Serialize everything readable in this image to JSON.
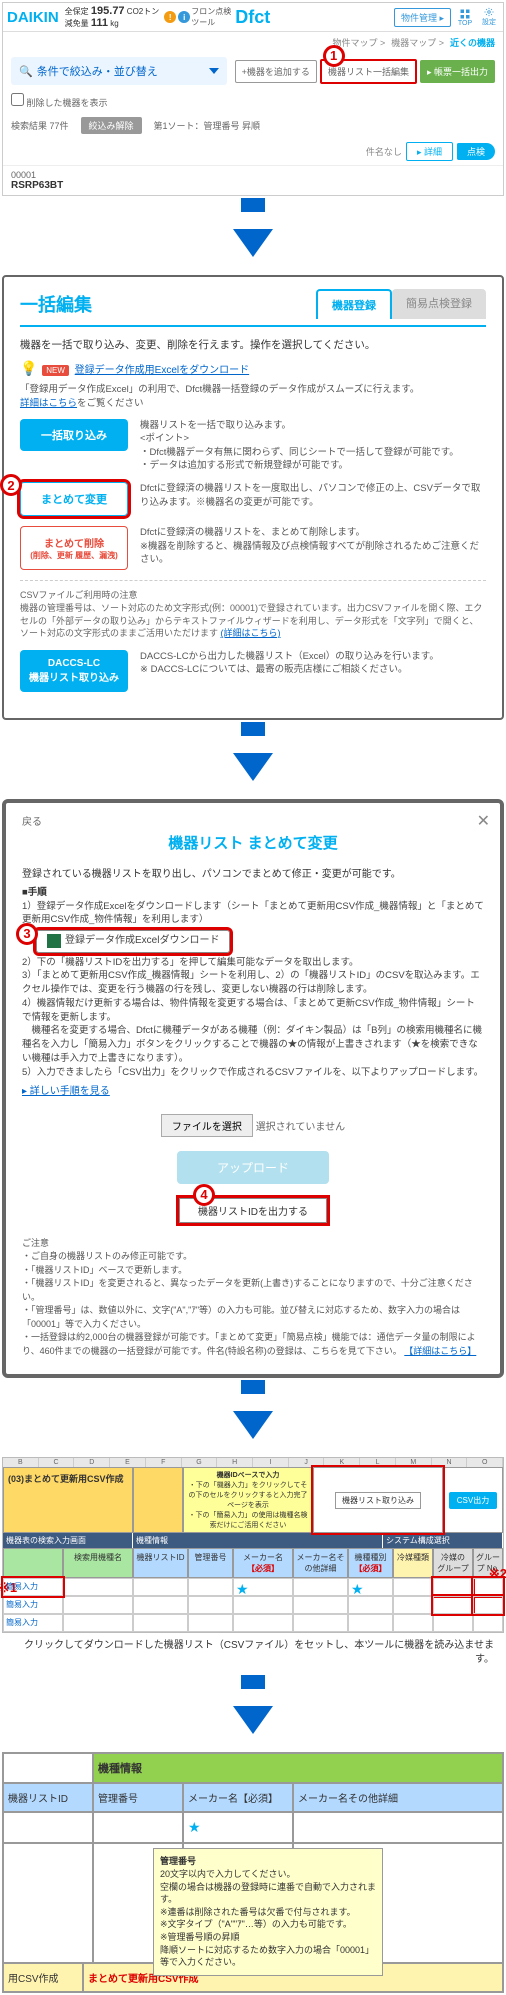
{
  "panel1": {
    "logo": "DAIKIN",
    "stats_l1_label": "全保定",
    "stats_l1_val": "195.77",
    "stats_l1_unit": "CO2トン",
    "stats_l2_label": "減免量",
    "stats_l2_val": "111",
    "stats_l2_unit": "kg",
    "badge1": "!",
    "badge2": "i",
    "title_pre": "フロン点検\nツール",
    "title": "Dfct",
    "mgmt_btn": "物件管理 ▸",
    "ico_top": "TOP",
    "ico_set": "設定",
    "breadcrumb": [
      "物件マップ >",
      "機器マップ >",
      "近くの機器"
    ],
    "filter": "条件で絞込み・並び替え",
    "act_add": "+機器を追加する",
    "act_bulk": "機器リスト一括編集",
    "act_out": "帳票一括出力",
    "chk_label": "削除した機器を表示",
    "result_count": "検索結果  77件",
    "tag_clear": "絞込み解除",
    "sort": "第1ソート：管理番号 昇順",
    "no_hdr": "件名なし",
    "detail": "詳細",
    "tenken": "点検",
    "row_id": "00001",
    "row_model": "RSRP63BT"
  },
  "panel2": {
    "title": "一括編集",
    "tab_active": "機器登録",
    "tab_inactive": "簡易点検登録",
    "desc": "機器を一括で取り込み、変更、削除を行えます。操作を選択してください。",
    "new_badge": "NEW",
    "excel_link": "登録データ作成用Excelをダウンロード",
    "excel_desc": "「登録用データ作成Excel」の利用で、Dfct機器一括登録のデータ作成がスムーズに行えます。",
    "detail_link": "詳細はこちら",
    "detail_suffix": "をご覧ください",
    "btn_import": "一括取り込み",
    "import_desc": "機器リストを一括で取り込みます。\n<ポイント>\n・Dfct機器データ有無に関わらず、同じシートで一括して登録が可能です。\n・データは追加する形式で新規登録が可能です。",
    "btn_change": "まとめて変更",
    "change_desc": "Dfctに登録済の機器リストを一度取出し、パソコンで修正の上、CSVデータで取り込みます。※機器名の変更が可能です。",
    "btn_delete": "まとめて削除",
    "btn_delete_sub": "(削除、更新 履歴、漏洩)",
    "delete_desc": "Dfctに登録済の機器リストを、まとめて削除します。\n※機器を削除すると、機器情報及び点検情報すべてが削除されるためご注意ください。",
    "csv_note_title": "CSVファイルご利用時の注意",
    "csv_note_body": "機器の管理番号は、ソート対応のため文字形式(例：00001)で登録されています。出力CSVファイルを開く際、エクセルの「外部データの取り込み」からテキストファイルウィザードを利用し、データ形式を「文字列」で開くと、ソート対応の文字形式のままご活用いただけます",
    "csv_note_link": "(詳細はこちら)",
    "btn_daccs": "DACCS-LC\n機器リスト取り込み",
    "daccs_desc": "DACCS-LCから出力した機器リスト（Excel）の取り込みを行います。\n※ DACCS-LCについては、最寄の販売店様にご相談ください。"
  },
  "panel3": {
    "back": "戻る",
    "title": "機器リスト まとめて変更",
    "desc": "登録されている機器リストを取り出し、パソコンでまとめて修正・変更が可能です。",
    "steps_head": "■手順",
    "step1": "1）登録データ作成Excelをダウンロードします（シート「まとめて更新用CSV作成_機器情報」と「まとめて更新用CSV作成_物件情報」を利用します）",
    "dl_btn": "登録データ作成Excelダウンロード",
    "step2": "2）下の「機器リストIDを出力する」を押して編集可能なデータを取出します。",
    "step3": "3）「まとめて更新用CSV作成_機器情報」シートを利用し、2）の「機器リストID」のCSVを取込みます。エクセル操作では、変更を行う機器の行を残し、変更しない機器の行は削除します。",
    "step4": "4）機器情報だけ更新する場合は、物件情報を変更する場合は、「まとめて更新CSV作成_物件情報」シートで情報を更新します。\n　機種名を変更する場合、Dfctに機種データがある機種（例：ダイキン製品）は「B列」の検索用機種名に機種名を入力し「簡易入力」ボタンをクリックすることで機器の★の情報が上書きされます（★を検索できない機種は手入力で上書きになります）。",
    "step5": "5）入力できましたら「CSV出力」をクリックで作成されるCSVファイルを、以下よりアップロードします。",
    "detail_link": "▸ 詳しい手順を見る",
    "file_btn": "ファイルを選択",
    "file_none": "選択されていません",
    "upload": "アップロード",
    "id_out": "機器リストIDを出力する",
    "notes_head": "ご注意",
    "note1": "・ご自身の機器リストのみ修正可能です。",
    "note2": "・「機器リストID」ベースで更新します。",
    "note3": "・「機器リストID」を変更されると、異なったデータを更新(上書き)することになりますので、十分ご注意ください。",
    "note4": "・「管理番号」は、数値以外に、文字(\"A\",\"ｱ\"等）の入力も可能。並び替えに対応するため、数字入力の場合は「00001」等で入力ください。",
    "note5": "・一括登録は約2,000台の機器登録が可能です。「まとめて変更」「簡易点検」機能では：通信データ量の制限により、460件までの機器の一括登録が可能です。件名(特設名称)の登録は、こちらを見て下さい。",
    "note5_link": "【詳細はこちら】"
  },
  "panel4": {
    "cols": [
      "B",
      "C",
      "D",
      "E",
      "F",
      "G",
      "H",
      "I",
      "J",
      "K",
      "L",
      "M",
      "N",
      "O"
    ],
    "topA": "(03)まとめて更新用CSV作成",
    "instr_head": "機器IDベースで入力",
    "instr1": "・下の「機器入力」をクリックしてその下のセルをクリックすると入力完了ページを表示",
    "instr2": "・下の「簡易入力」の使用は機種名検索だけにご活用ください",
    "btnC": "機器リスト取り込み",
    "btnD": "CSV出力",
    "subA": "機器表の検索入力画面",
    "subB": "機種情報",
    "subC": "システム構成選択",
    "h_search": "検索用機種名",
    "h_id": "機器リストID",
    "h_mgmt": "管理番号",
    "h_maker": "メーカー名",
    "h_maker2": "メーカー名その他詳細",
    "h_kind": "機種種別",
    "h_ref": "冷媒種類",
    "h_grp": "冷媒の\nグループ",
    "h_grpn": "グループ No.",
    "required": "【必須】",
    "body_link": "簡易入力",
    "caption": "クリックしてダウンロードした機器リスト（CSVファイル）をセットし、本ツールに機器を読み込ませます。"
  },
  "panel5": {
    "top": "機種情報",
    "h_id": "機器リストID",
    "h_mgmt": "管理番号",
    "h_maker": "メーカー名【必須】",
    "h_maker2": "メーカー名その他詳細",
    "star": "★",
    "tooltip_title": "管理番号",
    "tooltip_l1": "20文字以内で入力してください。",
    "tooltip_l2": "空欄の場合は機器の登録時に連番で自動で入力されます。",
    "tooltip_l3": "※連番は削除された番号は欠番で付与されます。",
    "tooltip_l4": "※文字タイプ（\"A\"\"ｱ\"…等）の入力も可能です。",
    "tooltip_l5": "※管理番号順の昇順\n降順ソートに対応するため数字入力の場合「00001」等で入力ください。",
    "bottom1": "用CSV作成",
    "bottom2": "まとめて更新用CSV作成"
  }
}
